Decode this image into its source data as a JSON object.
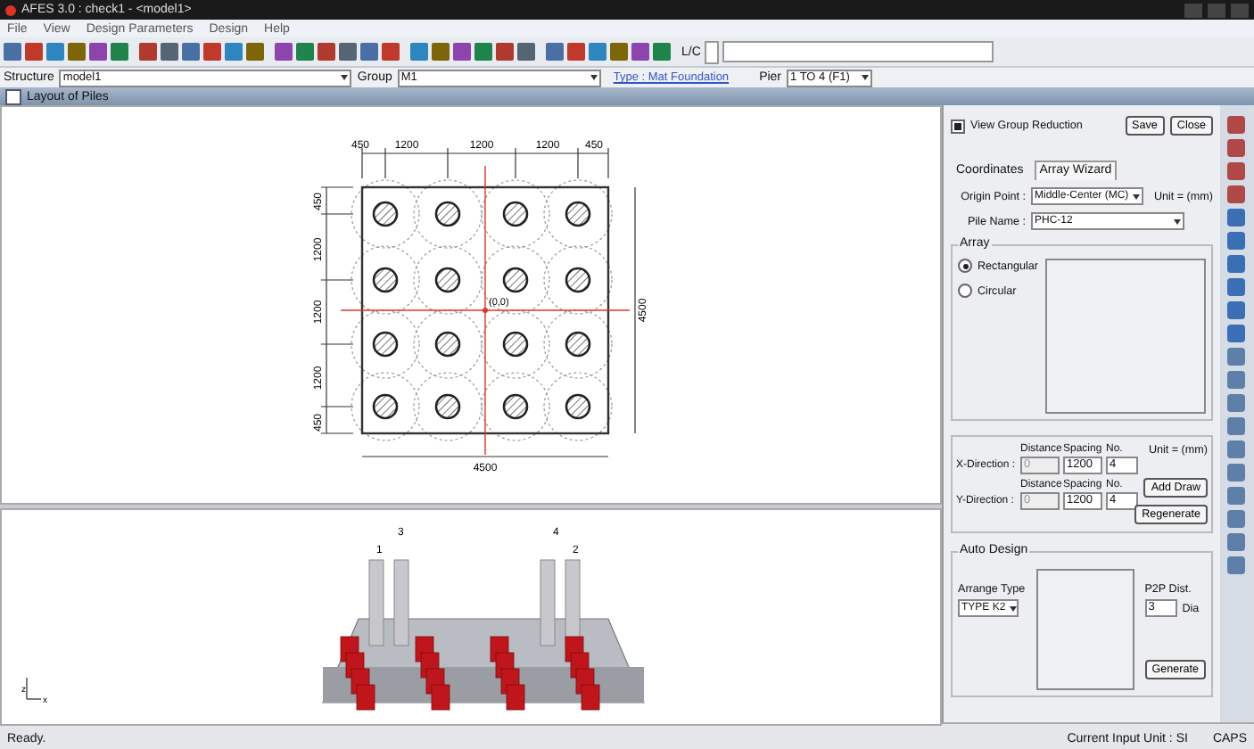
{
  "window": {
    "title": "AFES 3.0 : check1 - <model1>"
  },
  "menu": [
    "File",
    "View",
    "Design Parameters",
    "Design",
    "Help"
  ],
  "toolbar": {
    "lc_label": "L/C"
  },
  "selectors": {
    "structure_label": "Structure",
    "structure_value": "model1",
    "group_label": "Group",
    "group_value": "M1",
    "type_link": "Type : Mat  Foundation",
    "pier_label": "Pier",
    "pier_value": "1 TO 4 (F1)"
  },
  "panel_title": "Layout of Piles",
  "plan": {
    "top_dims": [
      "450",
      "1200",
      "1200",
      "1200",
      "450"
    ],
    "left_dims": [
      "450",
      "1200",
      "1200",
      "1200",
      "450"
    ],
    "bottom_dim": "4500",
    "right_dim": "4500",
    "origin_label": "(0,0)"
  },
  "elevation": {
    "pile_labels": [
      "1",
      "3",
      "4",
      "2"
    ],
    "axis_labels": [
      "z",
      "x"
    ]
  },
  "right_panel": {
    "view_group_reduction": {
      "label": "View Group Reduction",
      "checked": true
    },
    "save": "Save",
    "close": "Close",
    "tabs": [
      {
        "label": "Coordinates",
        "selected": false
      },
      {
        "label": "Array Wizard",
        "selected": true
      }
    ],
    "unit_label": "Unit = (mm)",
    "origin_point": {
      "label": "Origin Point :",
      "value": "Middle-Center (MC)"
    },
    "pile_name": {
      "label": "Pile Name :",
      "value": "PHC-12"
    },
    "array": {
      "title": "Array",
      "options": [
        {
          "label": "Rectangular",
          "selected": true
        },
        {
          "label": "Circular",
          "selected": false
        }
      ]
    },
    "directions": [
      {
        "label": "X-Direction :",
        "headings": [
          "Distance",
          "Spacing",
          "No."
        ],
        "distance": "0",
        "spacing": "1200",
        "no": "4"
      },
      {
        "label": "Y-Direction :",
        "headings": [
          "Distance",
          "Spacing",
          "No."
        ],
        "distance": "0",
        "spacing": "1200",
        "no": "4"
      }
    ],
    "direction_unit": "Unit = (mm)",
    "add_draw": "Add Draw",
    "regenerate": "Regenerate",
    "auto_design": {
      "title": "Auto Design",
      "arrange_label": "Arrange Type",
      "arrange_value": "TYPE K2",
      "p2p_label": "P2P Dist.",
      "p2p_value": "3",
      "dia_label": "Dia",
      "generate": "Generate"
    }
  },
  "status_bar": {
    "message": "Ready.",
    "unit": "Current Input Unit : SI",
    "caps": "CAPS"
  }
}
